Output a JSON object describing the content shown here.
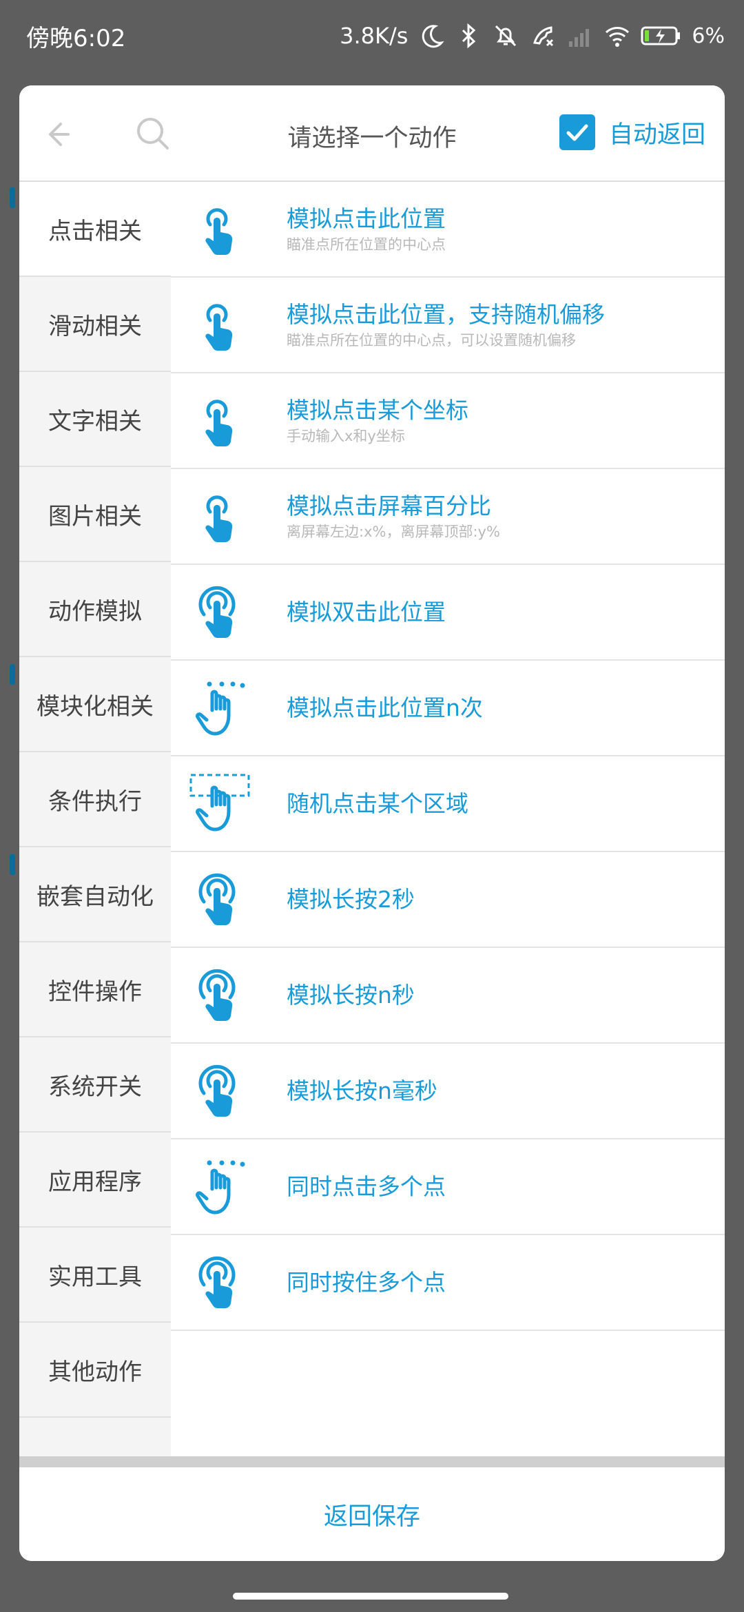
{
  "status_bar": {
    "time": "傍晚6:02",
    "net_speed": "3.8K/s",
    "battery": "6%",
    "icons": [
      "moon-icon",
      "bluetooth-icon",
      "mute-bell-icon",
      "call-icon",
      "signal-icon",
      "wifi-icon",
      "battery-charging-icon"
    ]
  },
  "header": {
    "back_icon": "back-arrow-icon",
    "search_icon": "search-icon",
    "title": "请选择一个动作",
    "auto_return_label": "自动返回",
    "auto_return_checked": true
  },
  "colors": {
    "accent": "#1a9bd9",
    "sidebar_bg": "#f4f4f4",
    "overlay": "#5e5e5e"
  },
  "categories": [
    {
      "label": "点击相关",
      "active": true
    },
    {
      "label": "滑动相关",
      "active": false
    },
    {
      "label": "文字相关",
      "active": false
    },
    {
      "label": "图片相关",
      "active": false
    },
    {
      "label": "动作模拟",
      "active": false
    },
    {
      "label": "模块化相关",
      "active": false
    },
    {
      "label": "条件执行",
      "active": false
    },
    {
      "label": "嵌套自动化",
      "active": false
    },
    {
      "label": "控件操作",
      "active": false
    },
    {
      "label": "系统开关",
      "active": false
    },
    {
      "label": "应用程序",
      "active": false
    },
    {
      "label": "实用工具",
      "active": false
    },
    {
      "label": "其他动作",
      "active": false
    }
  ],
  "actions": [
    {
      "title": "模拟点击此位置",
      "subtitle": "瞄准点所在位置的中心点",
      "icon": "tap-finger-icon"
    },
    {
      "title": "模拟点击此位置，支持随机偏移",
      "subtitle": "瞄准点所在位置的中心点，可以设置随机偏移",
      "icon": "tap-finger-icon"
    },
    {
      "title": "模拟点击某个坐标",
      "subtitle": "手动输入x和y坐标",
      "icon": "tap-finger-icon"
    },
    {
      "title": "模拟点击屏幕百分比",
      "subtitle": "离屏幕左边:x%，离屏幕顶部:y%",
      "icon": "tap-finger-icon"
    },
    {
      "title": "模拟双击此位置",
      "subtitle": "",
      "icon": "double-tap-icon"
    },
    {
      "title": "模拟点击此位置n次",
      "subtitle": "",
      "icon": "multi-tap-hand-icon"
    },
    {
      "title": "随机点击某个区域",
      "subtitle": "",
      "icon": "area-tap-hand-icon"
    },
    {
      "title": "模拟长按2秒",
      "subtitle": "",
      "icon": "long-press-icon"
    },
    {
      "title": "模拟长按n秒",
      "subtitle": "",
      "icon": "long-press-icon"
    },
    {
      "title": "模拟长按n毫秒",
      "subtitle": "",
      "icon": "long-press-icon"
    },
    {
      "title": "同时点击多个点",
      "subtitle": "",
      "icon": "multi-tap-hand-icon"
    },
    {
      "title": "同时按住多个点",
      "subtitle": "",
      "icon": "long-press-icon"
    }
  ],
  "footer": {
    "save_label": "返回保存"
  }
}
